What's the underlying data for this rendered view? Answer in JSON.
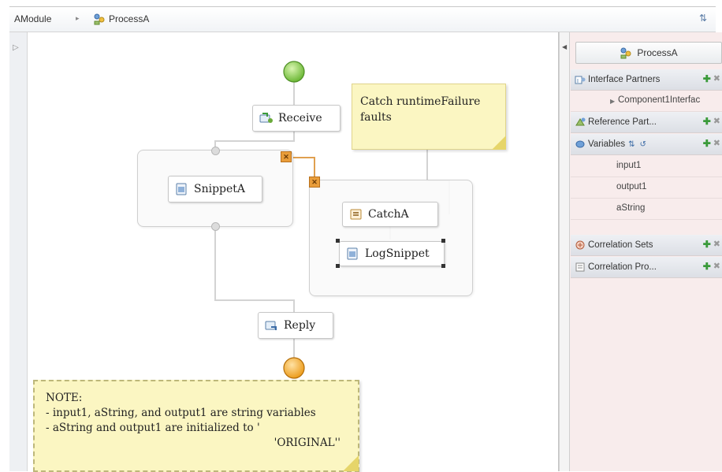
{
  "breadcrumb": {
    "module": "AModule",
    "process": "ProcessA"
  },
  "canvas": {
    "nodes": {
      "receive": "Receive",
      "snippet_a": "SnippetA",
      "catch_a": "CatchA",
      "log_snippet": "LogSnippet",
      "reply": "Reply"
    },
    "catch_note": {
      "line1": "Catch runtimeFailure",
      "line2": "faults"
    },
    "bottom_note": {
      "line1": "NOTE:",
      "line2": "- input1, aString, and output1 are string variables",
      "line3": "- aString and output1 are initialized to '",
      "line4": "'ORIGINAL''"
    }
  },
  "tray": {
    "title": "ProcessA",
    "interface_partners": "Interface Partners",
    "interface_item": "Component1Interfac",
    "reference_partners": "Reference Part...",
    "variables": "Variables",
    "variable_items": [
      "input1",
      "output1",
      "aString"
    ],
    "correlation_sets": "Correlation Sets",
    "correlation_properties": "Correlation Pro..."
  },
  "colors": {
    "start_green": "#8ccc4c",
    "end_orange": "#f0a020",
    "note_yellow": "#fbf6c2",
    "tray_bg": "#f8ecec"
  }
}
